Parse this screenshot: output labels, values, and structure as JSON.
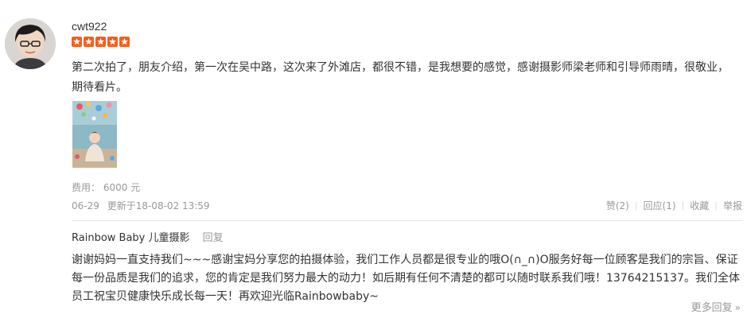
{
  "review": {
    "username": "cwt922",
    "rating": 5,
    "star_color": "#f55e20",
    "text": "第二次拍了，朋友介绍，第一次在吴中路，这次来了外滩店，都很不错，是我想要的感觉，感谢摄影师梁老师和引导师雨晴，很敬业，期待看片。",
    "cost_label": "费用：",
    "cost_value": "6000 元",
    "date": "06-29",
    "updated": "更新于18-08-02 13:59"
  },
  "actions": {
    "like": "赞(2)",
    "reply": "回应(1)",
    "favorite": "收藏",
    "report": "举报"
  },
  "merchant_reply": {
    "name": "Rainbow Baby 儿童摄影",
    "reply_link": "回复",
    "text": "谢谢妈妈一直支持我们~~~感谢宝妈分享您的拍摄体验，我们工作人员都是很专业的哦O(∩_∩)O服务好每一位顾客是我们的宗旨、保证每一份品质是我们的追求，您的肯定是我们努力最大的动力！如后期有任何不清楚的都可以随时联系我们哦！13764215137。我们全体员工祝宝贝健康快乐成长每一天！再欢迎光临Rainbowbaby~"
  },
  "more_replies": "更多回复"
}
